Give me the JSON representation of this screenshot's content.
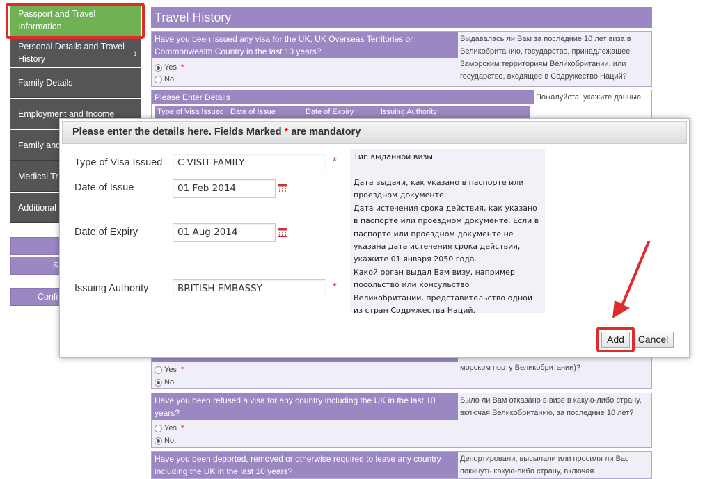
{
  "sidebar": {
    "items": [
      {
        "label": "Passport and Travel Information",
        "active": true
      },
      {
        "label": "Personal Details and Travel History",
        "chevron": true
      },
      {
        "label": "Family Details"
      },
      {
        "label": "Employment and Income"
      },
      {
        "label": "Family and UK"
      },
      {
        "label": "Medical Tr"
      },
      {
        "label": "Additional"
      }
    ],
    "buttons": [
      {
        "label": ""
      },
      {
        "label": "S"
      },
      {
        "label": "Confi"
      }
    ]
  },
  "main": {
    "title": "Travel History",
    "q1": {
      "question": "Have you been issued any visa for the UK, UK Overseas Territories or Commonwealth Country in the last 10 years?",
      "question_ru": "Выдавалась ли Вам за последние 10 лет виза в Великобританию, государство, принадлежащее Заморским территориям Великобритании, или государство, входящее в Содружество Наций?",
      "yes": "Yes",
      "no": "No",
      "selected": "Yes"
    },
    "details": {
      "header": "Please Enter Details",
      "header_ru": "Пожалуйста, укажите данные.",
      "columns": [
        "Type of Visa Issued",
        "Date of Issue",
        "Date of Expiry",
        "Issuing Authority"
      ]
    },
    "q2": {
      "question_ru_tail": "морском порту Великобритании)?",
      "yes": "Yes",
      "no": "No",
      "selected": "No"
    },
    "q3": {
      "question": "Have you been refused a visa for any country including the UK in the last 10 years?",
      "question_ru": "Было ли Вам отказано в визе в какую-либо страну, включая Великобританию, за последние 10 лет?",
      "yes": "Yes",
      "no": "No",
      "selected": "No"
    },
    "q4": {
      "question": "Have you been deported, removed or otherwise required to leave any country including the UK in the last 10 years?",
      "question_ru": "Депортировали, высылали или просили ли Вас покинуть какую-либо страну, включая"
    }
  },
  "modal": {
    "title_pre": "Please enter the details here. Fields Marked",
    "title_star": "*",
    "title_post": "are mandatory",
    "fields": {
      "visa_type_label": "Type of Visa Issued",
      "visa_type_value": "C-VISIT-FAMILY",
      "issue_label": "Date of Issue",
      "issue_value": "01 Feb 2014",
      "expiry_label": "Date of Expiry",
      "expiry_value": "01 Aug 2014",
      "authority_label": "Issuing Authority",
      "authority_value": "BRITISH EMBASSY",
      "required_mark": "*"
    },
    "hints": {
      "visa_type": "Тип выданной визы",
      "issue": "Дата выдачи, как указано в паспорте или проездном документе",
      "expiry": "Дата истечения срока действия, как указано в паспорте или проездном документе. Если в паспорте или проездном документе не указана дата истечения срока действия, укажите 01 января 2050 года.",
      "authority": "Какой орган выдал Вам визу, например посольство или консульство Великобритании, представительство одной из стран Содружества Наций."
    },
    "add_label": "Add",
    "cancel_label": "Cancel"
  },
  "colors": {
    "accent_purple": "#9b87c2",
    "active_green": "#6fb153",
    "sidebar_dark": "#555555",
    "highlight_red": "#e02b2b",
    "required_red": "#dd1111"
  },
  "icons": [
    "calendar-icon",
    "chevron-right-icon",
    "annotation-arrow"
  ]
}
